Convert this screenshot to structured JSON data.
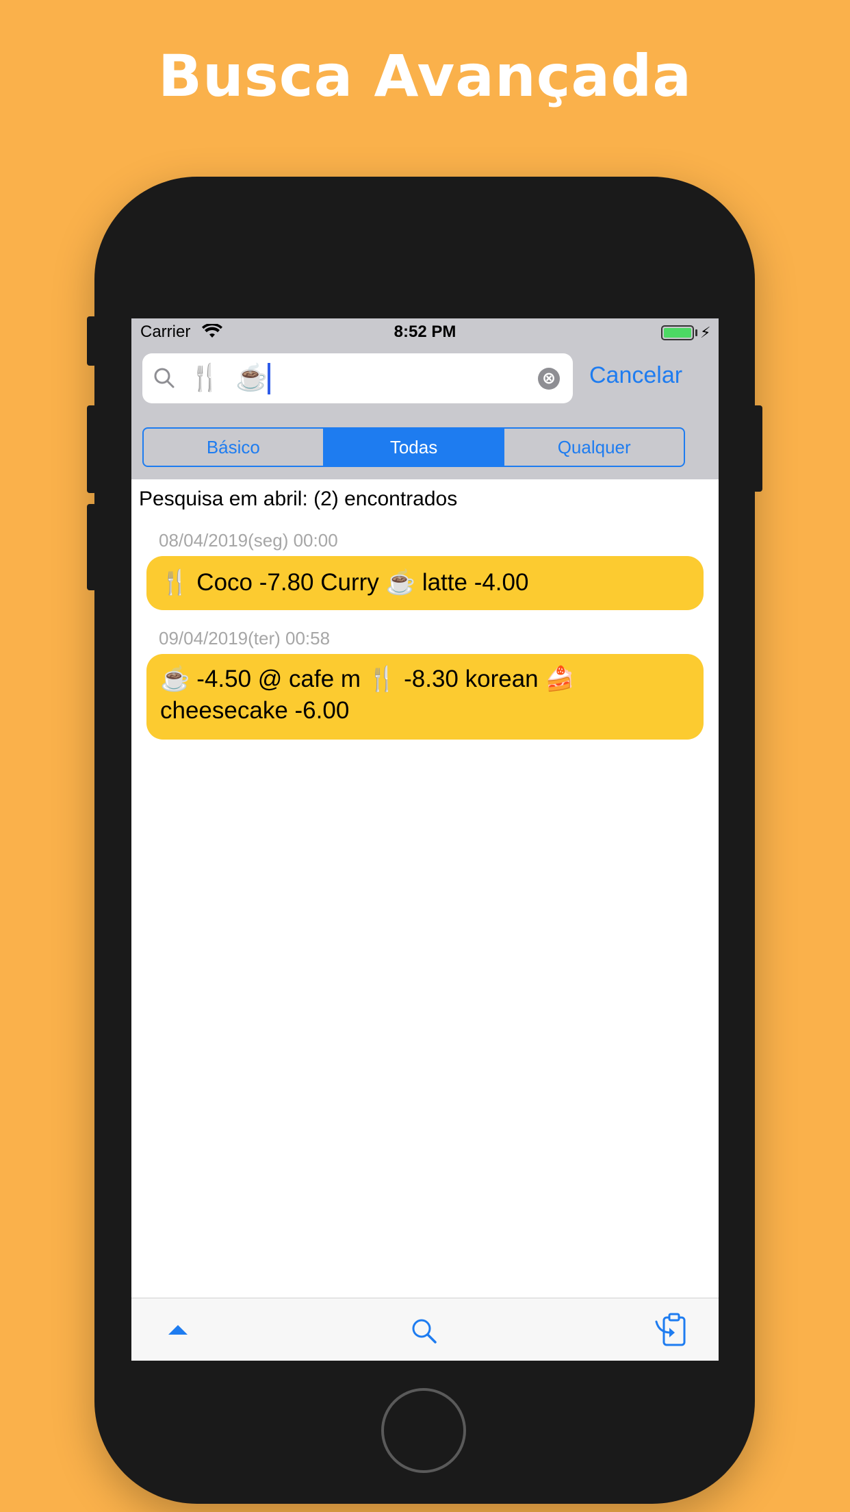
{
  "headline": "Busca Avançada",
  "status_bar": {
    "carrier": "Carrier",
    "time": "8:52 PM",
    "charging_symbol": "⚡"
  },
  "search": {
    "query": "🍴  ☕️ ",
    "cancel_label": "Cancelar",
    "clear_icon": "⊗"
  },
  "segments": {
    "items": [
      "Básico",
      "Todas",
      "Qualquer"
    ],
    "selected": "Todas"
  },
  "results": {
    "header": "Pesquisa em abril: (2) encontrados",
    "entries": [
      {
        "date": "08/04/2019(seg) 00:00",
        "text": "🍴 Coco -7.80 Curry ☕️ latte -4.00"
      },
      {
        "date": "09/04/2019(ter) 00:58",
        "text": "☕️ -4.50 @ cafe m 🍴 -8.30 korean 🍰 cheesecake -6.00"
      }
    ]
  },
  "tab_bar": {
    "icons": [
      "chevron-up-icon",
      "search-icon",
      "clipboard-export-icon"
    ]
  },
  "colors": {
    "background": "#FAB14B",
    "accent": "#1E7CF0",
    "bubble": "#FCCB30",
    "nav_gray": "#C9C9CE"
  }
}
